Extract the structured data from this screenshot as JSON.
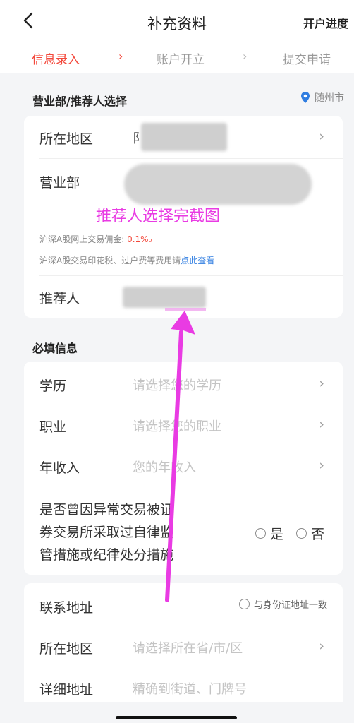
{
  "header": {
    "back_icon": "chevron-left-icon",
    "title": "补充资料",
    "progress_link": "开户进度"
  },
  "steps": [
    {
      "label": "信息录入",
      "active": true
    },
    {
      "label": "账户开立",
      "active": false
    },
    {
      "label": "提交申请",
      "active": false
    }
  ],
  "step_separator": "›",
  "section1": {
    "title": "营业部/推荐人选择",
    "location_icon": "location-pin-icon",
    "location": "随州市",
    "rows": {
      "region_label": "所在地区",
      "region_value": "阝",
      "branch_label": "营业部",
      "commission_label": "沪深A股网上交易佣金:",
      "commission_value": "0.1%₀",
      "fee_note_prefix": "沪深A股交易印花税、过户费等费用请",
      "fee_note_link": "点此查看",
      "referrer_label": "推荐人"
    },
    "annotation": "推荐人选择完截图"
  },
  "section2": {
    "title": "必填信息",
    "education_label": "学历",
    "education_placeholder": "请选择您的学历",
    "occupation_label": "职业",
    "occupation_placeholder": "请选择您的职业",
    "income_label": "年收入",
    "income_placeholder": "您的年收入",
    "question_line1": "是否曾因异常交易被证",
    "question_line2": "券交易所采取过自律监",
    "question_line3": "管措施或纪律处分措施",
    "yes": "是",
    "no": "否"
  },
  "section3": {
    "contact_label": "联系地址",
    "same_as_id": "与身份证地址一致",
    "region_label": "所在地区",
    "region_placeholder": "请选择所在省/市/区",
    "detail_label": "详细地址",
    "detail_placeholder": "精确到街道、门牌号"
  },
  "chevron": "›",
  "colors": {
    "accent": "#f3483b",
    "annotation": "#e93be3",
    "link": "#2f7de1"
  }
}
